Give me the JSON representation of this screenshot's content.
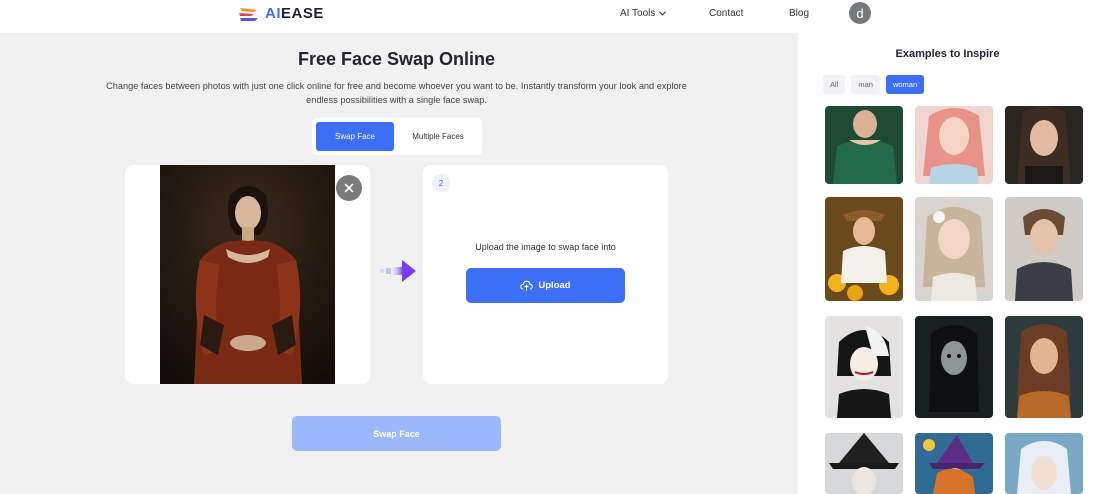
{
  "header": {
    "logo_prefix": "AI",
    "logo_suffix": "EASE",
    "nav": {
      "ai_tools": "AI Tools",
      "contact": "Contact",
      "blog": "Blog"
    },
    "avatar_letter": "d"
  },
  "main": {
    "title": "Free Face Swap Online",
    "subtitle": "Change faces between photos with just one click online for free and become whoever you want to be. Instantly transform your look and explore endless possibilities with a single face swap.",
    "tabs": [
      {
        "label": "Swap Face",
        "active": true
      },
      {
        "label": "Multiple Faces",
        "active": false
      }
    ],
    "target_card": {
      "step": "2",
      "prompt": "Upload the image to swap face into",
      "upload_label": "Upload"
    },
    "swap_button": "Swap Face"
  },
  "examples": {
    "title": "Examples to Inspire",
    "filters": [
      {
        "label": "All",
        "active": false
      },
      {
        "label": "man",
        "active": false
      },
      {
        "label": "woman",
        "active": true
      }
    ]
  },
  "colors": {
    "accent": "#3c6ef6",
    "accent_disabled": "#9db7fb"
  },
  "icons": {
    "close": "close-icon",
    "upload": "cloud-upload-icon",
    "arrow": "arrow-right-icon",
    "chevron": "chevron-down-icon"
  }
}
